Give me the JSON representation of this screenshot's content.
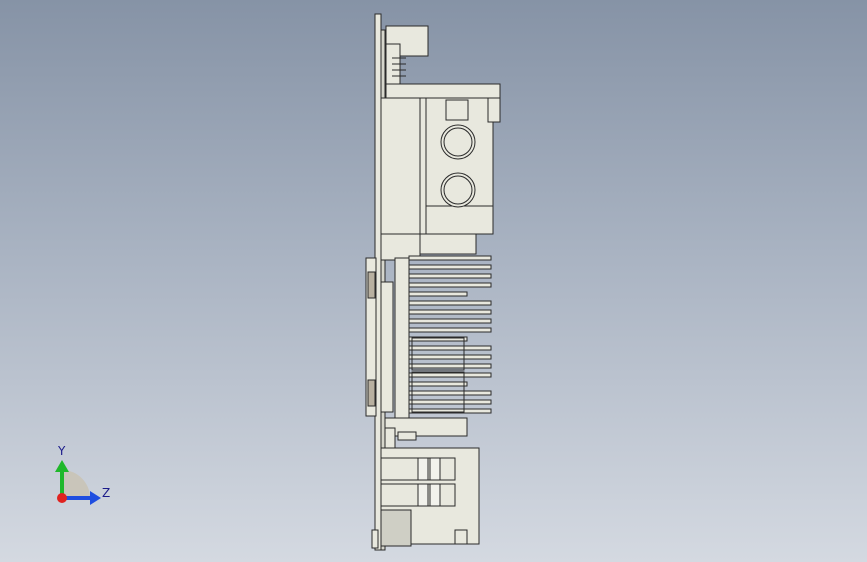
{
  "view": {
    "background_top": "#8693a6",
    "background_bottom": "#d4d9e1",
    "part_fill": "#e8e8de",
    "part_edge": "#2a2a2a",
    "part_shadow": "#c8c8be"
  },
  "triad": {
    "y_label": "Y",
    "z_label": "Z",
    "y_color": "#1fb82a",
    "z_color": "#1f4ee0",
    "x_color": "#e0221f"
  }
}
